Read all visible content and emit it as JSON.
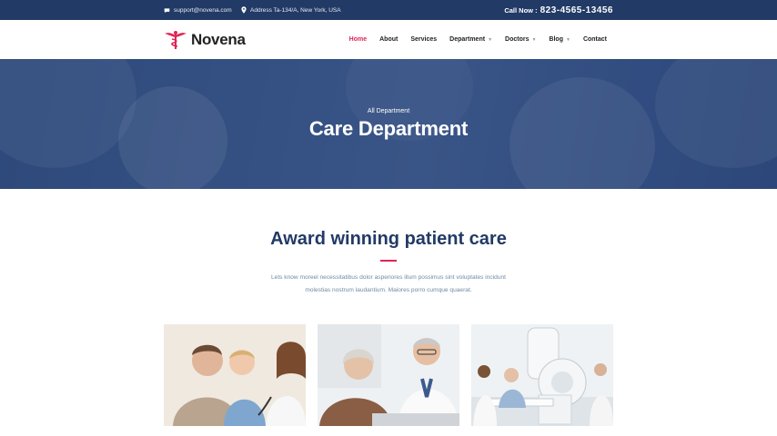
{
  "topbar": {
    "email": "support@novena.com",
    "address": "Address Ta-134/A, New York, USA",
    "call_label": "Call Now :",
    "phone": "823-4565-13456",
    "icons": [
      "chat-icon",
      "location-pin-icon"
    ]
  },
  "nav": {
    "brand": "Novena",
    "items": [
      {
        "label": "Home",
        "active": true
      },
      {
        "label": "About"
      },
      {
        "label": "Services"
      },
      {
        "label": "Department",
        "dropdown": true
      },
      {
        "label": "Doctors",
        "dropdown": true
      },
      {
        "label": "Blog",
        "dropdown": true
      },
      {
        "label": "Contact"
      }
    ]
  },
  "hero": {
    "subtitle": "All Department",
    "title": "Care Department"
  },
  "section": {
    "title": "Award winning patient care",
    "text_line1": "Lets know moreel necessitatibus dolor asperiores illum possimus sint voluptates incidunt",
    "text_line2": "molestias nostrum laudantium. Maiores porro cumque quaerat."
  },
  "colors": {
    "primary": "#223a66",
    "accent": "#e12454",
    "muted_text": "#6f8ba4"
  }
}
